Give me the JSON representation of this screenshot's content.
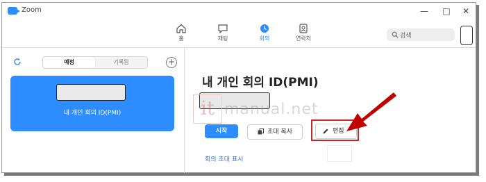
{
  "window": {
    "title": "Zoom",
    "controls": {
      "minimize": "—",
      "maximize": "□",
      "close": "✕"
    }
  },
  "nav": {
    "tabs": [
      {
        "label": "홈",
        "icon": "home-icon",
        "active": false
      },
      {
        "label": "채팅",
        "icon": "chat-icon",
        "active": false
      },
      {
        "label": "회의",
        "icon": "clock-icon",
        "active": true
      },
      {
        "label": "연락처",
        "icon": "contacts-icon",
        "active": false
      }
    ],
    "search_placeholder": "검색"
  },
  "left": {
    "segment": {
      "upcoming": "예정",
      "recorded": "기록됨"
    },
    "add_symbol": "+",
    "pmi_card_label": "내 개인 회의 ID(PMI)"
  },
  "main": {
    "title": "내 개인 회의 ID(PMI)",
    "buttons": {
      "start": "시작",
      "copy_invite": "초대 복사",
      "edit": "편집"
    },
    "show_invite_link": "회의 초대 표시"
  },
  "watermark": {
    "logo": "it",
    "text": "manual.net"
  },
  "colors": {
    "accent": "#2d8cff",
    "highlight": "#c62828",
    "arrow": "#c00000"
  }
}
